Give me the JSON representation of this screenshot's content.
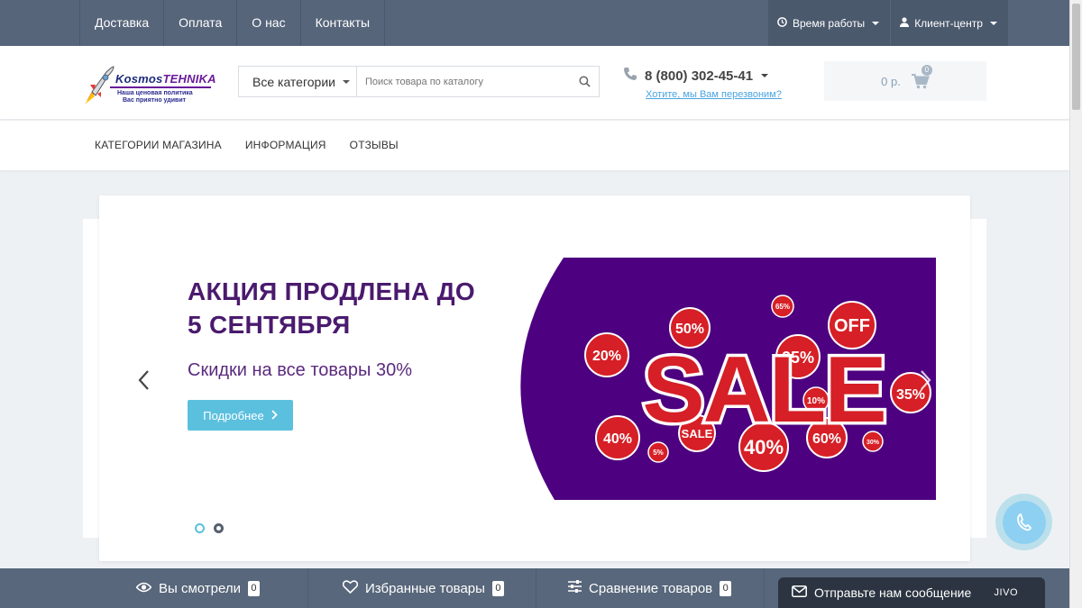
{
  "topbar": {
    "nav": [
      {
        "label": "Доставка"
      },
      {
        "label": "Оплата"
      },
      {
        "label": "О нас"
      },
      {
        "label": "Контакты"
      }
    ],
    "work_hours": "Время работы",
    "client_center": "Клиент-центр"
  },
  "header": {
    "logo": {
      "brand_part1": "Kosmos",
      "brand_part2": "TEHNIKA",
      "slogan_line1": "Наша ценовая политика",
      "slogan_line2": "Вас приятно удивит"
    },
    "search": {
      "category": "Все категории",
      "placeholder": "Поиск товара по каталогу"
    },
    "phone": {
      "number": "8 (800) 302-45-41",
      "callback": "Хотите, мы Вам перезвоним?"
    },
    "cart": {
      "sum": "0 р.",
      "count": "0"
    }
  },
  "mainnav": {
    "items": [
      {
        "label": "КАТЕГОРИИ МАГАЗИНА"
      },
      {
        "label": "ИНФОРМАЦИЯ"
      },
      {
        "label": "ОТЗЫВЫ"
      }
    ]
  },
  "slider": {
    "title": "АКЦИЯ ПРОДЛЕНА ДО 5 СЕНТЯБРЯ",
    "subtitle": "Скидки на все товары 30%",
    "button": "Подробнее",
    "image_text": "SALE",
    "tags": [
      "50%",
      "65%",
      "OFF",
      "25%",
      "10%",
      "35%",
      "40%",
      "60%",
      "30%",
      "5%",
      "SALE",
      "20%"
    ],
    "slides": 2,
    "active_slide": 1
  },
  "bottombar": {
    "viewed": {
      "label": "Вы смотрели",
      "count": "0"
    },
    "favorites": {
      "label": "Избранные товары",
      "count": "0"
    },
    "compare": {
      "label": "Сравнение товаров",
      "count": "0"
    }
  },
  "jivo": {
    "label": "Отправьте нам сообщение",
    "brand": "JIVO"
  },
  "colors": {
    "topbar": "#56657a",
    "accent": "#5bc0de",
    "title_purple": "#4a1a6e",
    "sale_bg": "#4d0080",
    "sale_red": "#d61f26"
  }
}
